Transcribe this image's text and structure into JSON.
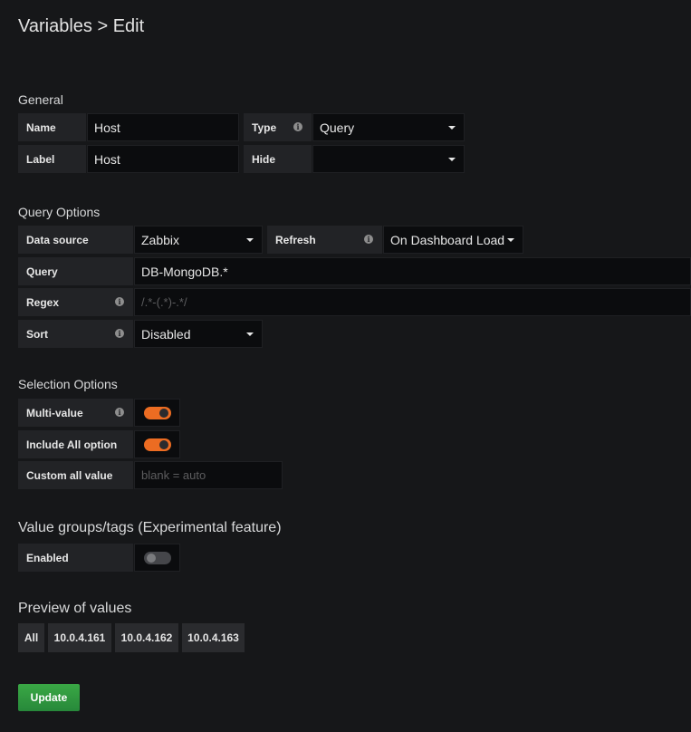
{
  "page": {
    "title": "Variables > Edit"
  },
  "general": {
    "title": "General",
    "name_label": "Name",
    "name_value": "Host",
    "type_label": "Type",
    "type_value": "Query",
    "label_label": "Label",
    "label_value": "Host",
    "hide_label": "Hide",
    "hide_value": ""
  },
  "query_options": {
    "title": "Query Options",
    "datasource_label": "Data source",
    "datasource_value": "Zabbix",
    "refresh_label": "Refresh",
    "refresh_value": "On Dashboard Load",
    "query_label": "Query",
    "query_value": "DB-MongoDB.*",
    "regex_label": "Regex",
    "regex_placeholder": "/.*-(.*)-.*/",
    "sort_label": "Sort",
    "sort_value": "Disabled"
  },
  "selection_options": {
    "title": "Selection Options",
    "multi_value_label": "Multi-value",
    "multi_value_enabled": true,
    "include_all_label": "Include All option",
    "include_all_enabled": true,
    "custom_all_label": "Custom all value",
    "custom_all_placeholder": "blank = auto"
  },
  "value_groups": {
    "title": "Value groups/tags (Experimental feature)",
    "enabled_label": "Enabled",
    "enabled": false
  },
  "preview": {
    "title": "Preview of values",
    "values": [
      "All",
      "10.0.4.161",
      "10.0.4.162",
      "10.0.4.163"
    ]
  },
  "actions": {
    "update_label": "Update"
  },
  "icons": {
    "info": "info-icon",
    "dropdown": "caret-down-icon"
  },
  "colors": {
    "background": "#161719",
    "toggle_on": "#ec6c22",
    "update_button": "#2e9a38"
  }
}
